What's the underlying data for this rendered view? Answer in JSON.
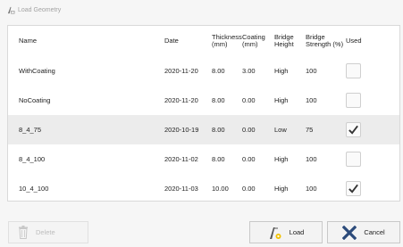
{
  "window": {
    "title": "Load Geometry"
  },
  "table": {
    "headers": {
      "name": "Name",
      "date": "Date",
      "thickness": "Thickness (mm)",
      "coating": "Coating (mm)",
      "bridge_height": "Bridge Height",
      "bridge_strength": "Bridge Strength (%)",
      "used": "Used"
    },
    "rows": [
      {
        "name": "WithCoating",
        "date": "2020-11-20",
        "thickness": "8.00",
        "coating": "3.00",
        "bridge_height": "High",
        "bridge_strength": "100",
        "used": false
      },
      {
        "name": "NoCoating",
        "date": "2020-11-20",
        "thickness": "8.00",
        "coating": "0.00",
        "bridge_height": "High",
        "bridge_strength": "100",
        "used": false
      },
      {
        "name": "8_4_75",
        "date": "2020-10-19",
        "thickness": "8.00",
        "coating": "0.00",
        "bridge_height": "Low",
        "bridge_strength": "75",
        "used": true
      },
      {
        "name": "8_4_100",
        "date": "2020-11-02",
        "thickness": "8.00",
        "coating": "0.00",
        "bridge_height": "High",
        "bridge_strength": "100",
        "used": false
      },
      {
        "name": "10_4_100",
        "date": "2020-11-03",
        "thickness": "10.00",
        "coating": "0.00",
        "bridge_height": "High",
        "bridge_strength": "100",
        "used": true
      }
    ],
    "selected_row": 2
  },
  "buttons": {
    "delete_label": "Delete",
    "load_label": "Load",
    "cancel_label": "Cancel"
  },
  "icons": {
    "delete": "trash-icon",
    "load": "load-geometry-icon",
    "cancel": "x-icon",
    "check": "checkmark-icon"
  },
  "colors": {
    "cancel_x": "#2b4a7a",
    "check": "#333333",
    "selected_row": "#ececec",
    "disabled_text": "#bdbdbd"
  }
}
